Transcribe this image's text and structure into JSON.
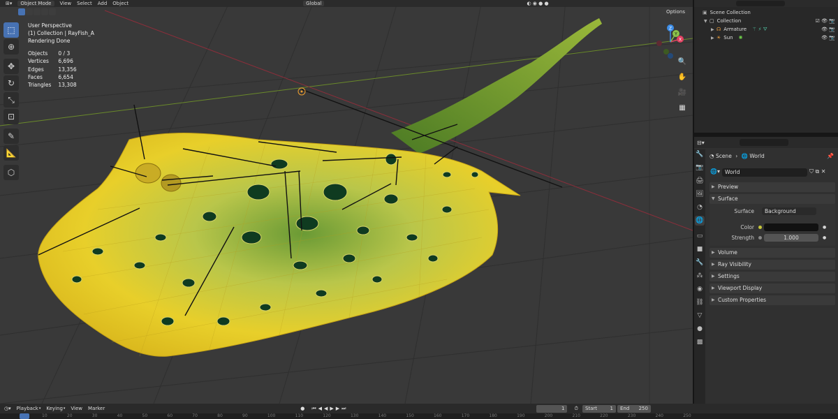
{
  "header": {
    "mode": "Object Mode",
    "menus": [
      "View",
      "Select",
      "Add",
      "Object"
    ],
    "transform_orientation": "Global",
    "options_label": "Options"
  },
  "overlay": {
    "view_name": "User Perspective",
    "collection": "(1) Collection | RayFish_A",
    "status": "Rendering Done"
  },
  "stats": [
    {
      "label": "Objects",
      "value": "0 / 3"
    },
    {
      "label": "Vertices",
      "value": "6,696"
    },
    {
      "label": "Edges",
      "value": "13,356"
    },
    {
      "label": "Faces",
      "value": "6,654"
    },
    {
      "label": "Triangles",
      "value": "13,308"
    }
  ],
  "gizmo": {
    "x": "X",
    "y": "Y",
    "z": "Z",
    "color_x": "#e04060",
    "color_y": "#8bc34a",
    "color_z": "#3d8ee8"
  },
  "outliner": {
    "root": "Scene Collection",
    "collection": "Collection",
    "items": [
      "Armature",
      "Sun"
    ]
  },
  "properties": {
    "breadcrumb_scene": "Scene",
    "breadcrumb_world": "World",
    "world_name": "World",
    "panels": {
      "preview": "Preview",
      "surface": "Surface",
      "volume": "Volume",
      "ray_visibility": "Ray Visibility",
      "settings": "Settings",
      "viewport_display": "Viewport Display",
      "custom_properties": "Custom Properties"
    },
    "surface": {
      "surface_label": "Surface",
      "surface_value": "Background",
      "color_label": "Color",
      "strength_label": "Strength",
      "strength_value": "1.000"
    }
  },
  "timeline": {
    "menus": [
      "Playback",
      "Keying",
      "View",
      "Marker"
    ],
    "current_frame": "1",
    "start_label": "Start",
    "start_value": "1",
    "end_label": "End",
    "end_value": "250",
    "ruler": [
      "10",
      "20",
      "30",
      "40",
      "50",
      "60",
      "70",
      "80",
      "90",
      "100",
      "110",
      "120",
      "130",
      "140",
      "150",
      "160",
      "170",
      "180",
      "190",
      "200",
      "210",
      "220",
      "230",
      "240",
      "250"
    ]
  },
  "colors": {
    "accent": "#4772b3",
    "viewport_bg": "#393939",
    "ray_yellow": "#e8cf2a",
    "ray_green": "#6d9e2e"
  }
}
